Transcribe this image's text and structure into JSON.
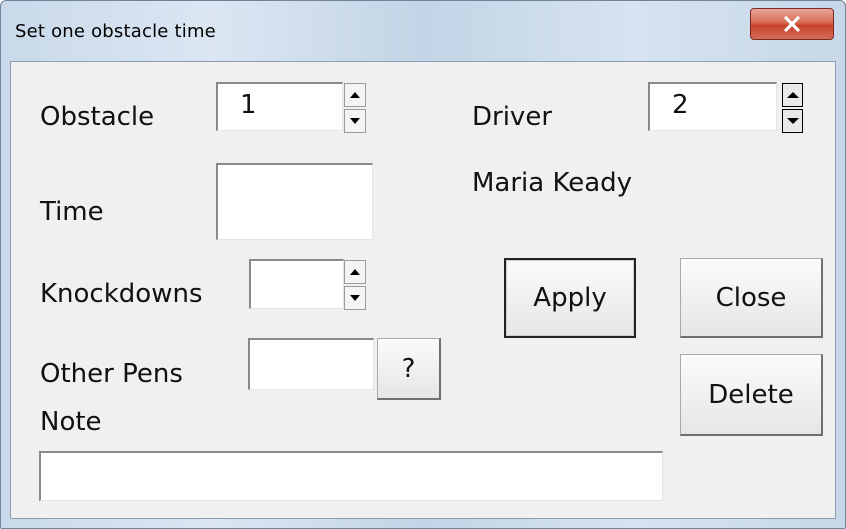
{
  "window": {
    "title": "Set one obstacle time",
    "close_glyph": "x"
  },
  "obstacle": {
    "label": "Obstacle",
    "value": "1"
  },
  "driver": {
    "label": "Driver",
    "value": "2",
    "name": "Maria Keady"
  },
  "time": {
    "label": "Time",
    "value": ""
  },
  "knockdowns": {
    "label": "Knockdowns",
    "value": ""
  },
  "other_pens": {
    "label": "Other Pens",
    "value": "",
    "help_label": "?"
  },
  "note": {
    "label": "Note",
    "value": ""
  },
  "buttons": {
    "apply": "Apply",
    "close": "Close",
    "delete": "Delete"
  },
  "colors": {
    "client_bg": "#f0f0f0",
    "close_red": "#c7402b"
  }
}
